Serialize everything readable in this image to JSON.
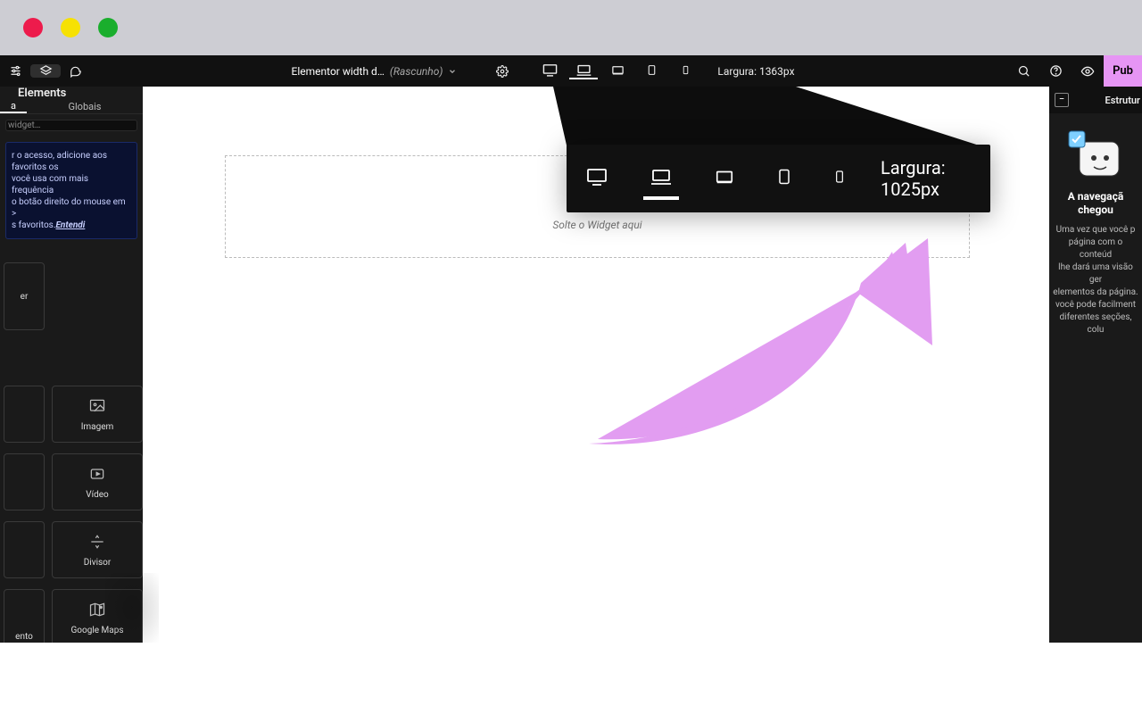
{
  "toolbar": {
    "doc_title": "Elementor width d…",
    "doc_status": "(Rascunho)",
    "width_label_small": "Largura: 1363px",
    "publish_label": "Pub"
  },
  "left_panel": {
    "title": "Elements",
    "tabs": {
      "a": "a",
      "global": "Globais"
    },
    "search_placeholder": "widget…",
    "tip_text_a": "r o acesso, adicione aos favoritos os",
    "tip_text_b": "você usa com mais frequência",
    "tip_text_c": "o botão direito do mouse em >",
    "tip_text_d": "s favoritos.",
    "tip_cta": "Entendi",
    "widgets": {
      "container": "er",
      "image": "Imagem",
      "video": "Vídeo",
      "divider": "Divisor",
      "maps": "Google Maps",
      "text_partial": "ento"
    }
  },
  "canvas": {
    "dropzone_text": "Solte o Widget aqui"
  },
  "right_panel": {
    "header": "Estrutur",
    "title": "A navegaçã\nchegou",
    "body": "Uma vez que você p\npágina com o conteúd\nlhe dará uma visão ger\nelementos da página.\nvocê pode facilment\ndiferentes seções, colu"
  },
  "zoom": {
    "label": "Largura: 1025px"
  }
}
